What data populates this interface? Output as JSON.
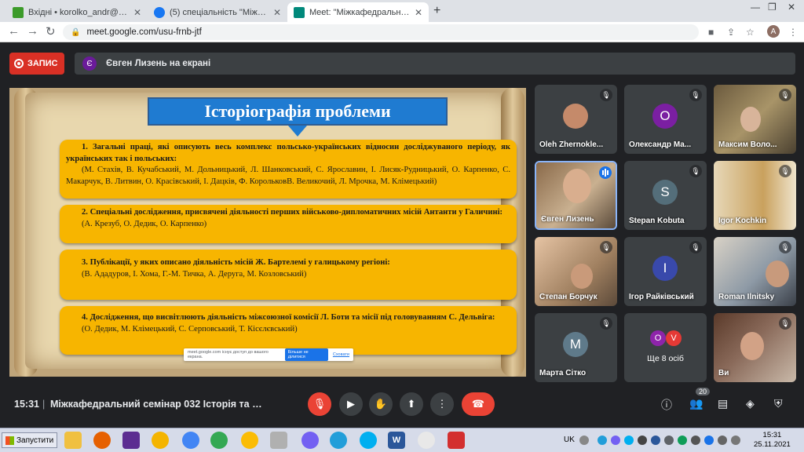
{
  "browser": {
    "tabs": [
      {
        "label": "Вхідні • korolko_andr@ukr.net",
        "icon_color": "#3c9b2a"
      },
      {
        "label": "(5) спеціальність \"Міжнародні е",
        "icon_color": "#1877f2"
      },
      {
        "label": "Meet: \"Міжкафедральний с",
        "icon_color": "#00897b"
      }
    ],
    "new_tab": "+",
    "url": "meet.google.com/usu-frnb-jtf",
    "profile_initial": "A"
  },
  "meet": {
    "record_label": "ЗАПИС",
    "presenter_initial": "Є",
    "presenter_label": "Євген Лизень на екрані",
    "slide": {
      "title": "Історіографія проблеми",
      "boxes": [
        {
          "heading": "1. Загальні праці, які описують весь комплекс польсько-українських відносин досліджуваного періоду, як українських так і польських:",
          "authors": "(М. Стахів, В. Кучабський, М. Дольницький, Л. Шанковський, С. Ярославин, І. Лисяк-Рудницький, О. Карпенко, С. Макарчук, В. Литвин, О. Красівський, І. Дацків, Ф. КорольковВ. Великочий, Л. Мрочка, М. Клімецький)"
        },
        {
          "heading": "2. Спеціальні дослідження, присвячені діяльності перших військово-дипломатичних місій Антанти у Галичині:",
          "authors": "(А. Крезуб, О. Дедик, О. Карпенко)"
        },
        {
          "heading": "3. Публікації, у яких описано діяльність місій Ж. Бартелемі у галицькому регіоні:",
          "authors": "(В. Ададуров, І. Хома, Г.-М. Тичка, А. Деруга, М. Козловський)"
        },
        {
          "heading": "4. Дослідження, що висвітлюють діяльність міжсоюзної комісії Л. Боти та місії під головуванням С. Дельвіга:",
          "authors": "(О. Дедик, М. Клімецький, С. Серповський, Т. Кісєлєвський)"
        }
      ],
      "toast": {
        "text": "meet.google.com існує доступ до вашого екрана.",
        "button": "Більше не ділитися",
        "link": "Сховати"
      }
    },
    "participants": [
      {
        "name": "Oleh Zhernokle...",
        "initial": "",
        "bg": "#3c4043",
        "type": "photo"
      },
      {
        "name": "Олександр Ма...",
        "initial": "О",
        "bg": "#7b1fa2",
        "type": "letter"
      },
      {
        "name": "Максим Воло...",
        "initial": "",
        "bg": "#8a7a5a",
        "type": "video"
      },
      {
        "name": "Євген Лизень",
        "initial": "",
        "bg": "#6d5a48",
        "type": "video"
      },
      {
        "name": "Stepan Kobuta",
        "initial": "S",
        "bg": "#546e7a",
        "type": "letter"
      },
      {
        "name": "Igor Kochkin",
        "initial": "",
        "bg": "#c9a15e",
        "type": "video"
      },
      {
        "name": "Степан Борчук",
        "initial": "",
        "bg": "#a08060",
        "type": "video"
      },
      {
        "name": "Ігор Райківський",
        "initial": "І",
        "bg": "#3949ab",
        "type": "letter"
      },
      {
        "name": "Roman Ilnitsky",
        "initial": "",
        "bg": "#8e9aa6",
        "type": "video"
      },
      {
        "name": "Марта Сітко",
        "initial": "М",
        "bg": "#5f7a8a",
        "type": "letter"
      },
      {
        "name": "Ще 8 осіб",
        "initial": "",
        "bg": "#3c4043",
        "type": "more",
        "chips": [
          "O",
          "V"
        ]
      },
      {
        "name": "Ви",
        "initial": "",
        "bg": "#6a4a3a",
        "type": "video"
      }
    ],
    "bottom": {
      "time": "15:31",
      "separator": "|",
      "meeting_title": "Міжкафедральний семінар 032 Історія та ар...",
      "participants_count": "20"
    }
  },
  "taskbar": {
    "start_label": "Запустити",
    "language": "UK",
    "time": "15:31",
    "date": "25.11.2021"
  }
}
